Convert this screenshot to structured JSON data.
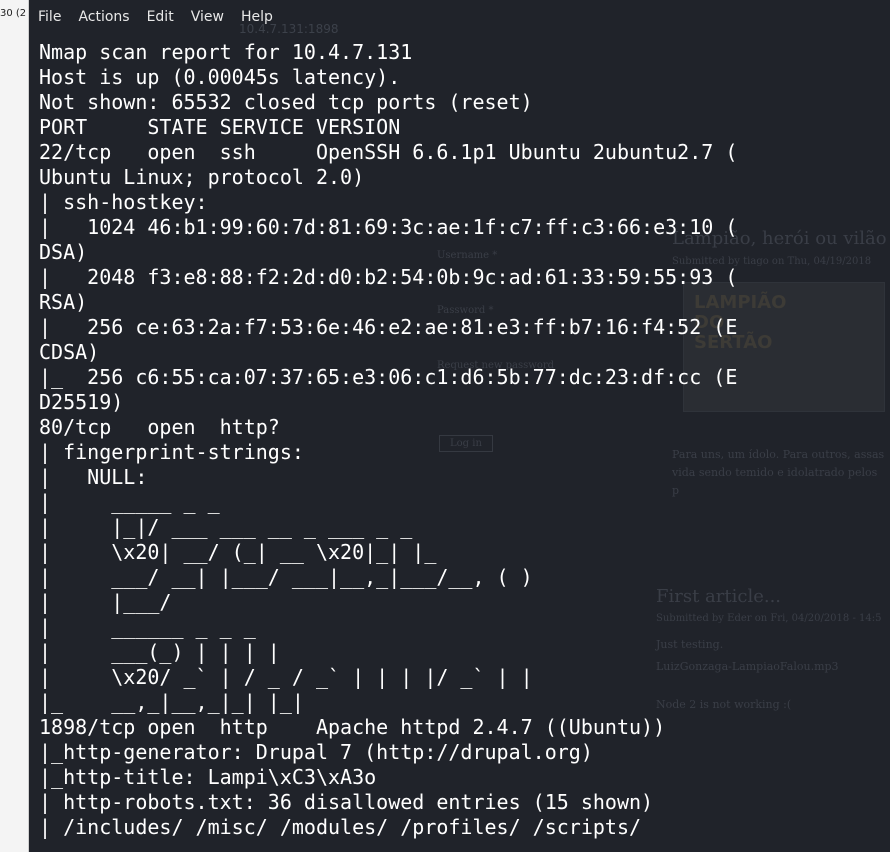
{
  "left_sliver": {
    "text": "30 (2"
  },
  "background_page": {
    "url_text": "10.4.7.131:1898",
    "article_title": "Lampião, herói ou vilão do",
    "submitted": "Submitted by tiago on Thu, 04/19/2018",
    "image_text": "LAMPIÃO DO SERTÃO",
    "body_text": "Para uns, um ídolo. Para outros, assas vida sendo temido e idolatrado pelos p",
    "first_article": "First article...",
    "submitted2": "Submitted by Eder on Fri, 04/20/2018 - 14:5",
    "just_testing": "Just testing.",
    "file_name": "LuizGonzaga-LampiaoFalou.mp3",
    "node_note": "Node 2 is not working :(",
    "login_username": "Username *",
    "login_password": "Password *",
    "login_forgot": "Request new password",
    "login_button": "Log in"
  },
  "menubar": {
    "items": [
      "File",
      "Actions",
      "Edit",
      "View",
      "Help"
    ]
  },
  "terminal": {
    "lines": [
      "Nmap scan report for 10.4.7.131",
      "Host is up (0.00045s latency).",
      "Not shown: 65532 closed tcp ports (reset)",
      "PORT     STATE SERVICE VERSION",
      "22/tcp   open  ssh     OpenSSH 6.6.1p1 Ubuntu 2ubuntu2.7 (",
      "Ubuntu Linux; protocol 2.0)",
      "| ssh-hostkey: ",
      "|   1024 46:b1:99:60:7d:81:69:3c:ae:1f:c7:ff:c3:66:e3:10 (",
      "DSA)",
      "|   2048 f3:e8:88:f2:2d:d0:b2:54:0b:9c:ad:61:33:59:55:93 (",
      "RSA)",
      "|   256 ce:63:2a:f7:53:6e:46:e2:ae:81:e3:ff:b7:16:f4:52 (E",
      "CDSA)",
      "|_  256 c6:55:ca:07:37:65:e3:06:c1:d6:5b:77:dc:23:df:cc (E",
      "D25519)",
      "80/tcp   open  http?",
      "| fingerprint-strings: ",
      "|   NULL: ",
      "|     _____ _ _",
      "|     |_|/ ___ ___ __ _ ___ _ _",
      "|     \\x20| __/ (_| __ \\x20|_| |_",
      "|     ___/ __| |___/ ___|__,_|___/__, ( )",
      "|     |___/",
      "|     ______ _ _ _",
      "|     ___(_) | | | |",
      "|     \\x20/ _` | / _ / _` | | | |/ _` | |",
      "|_    __,_|__,_|_| |_|",
      "1898/tcp open  http    Apache httpd 2.4.7 ((Ubuntu))",
      "|_http-generator: Drupal 7 (http://drupal.org)",
      "|_http-title: Lampi\\xC3\\xA3o",
      "| http-robots.txt: 36 disallowed entries (15 shown)",
      "| /includes/ /misc/ /modules/ /profiles/ /scripts/"
    ]
  }
}
